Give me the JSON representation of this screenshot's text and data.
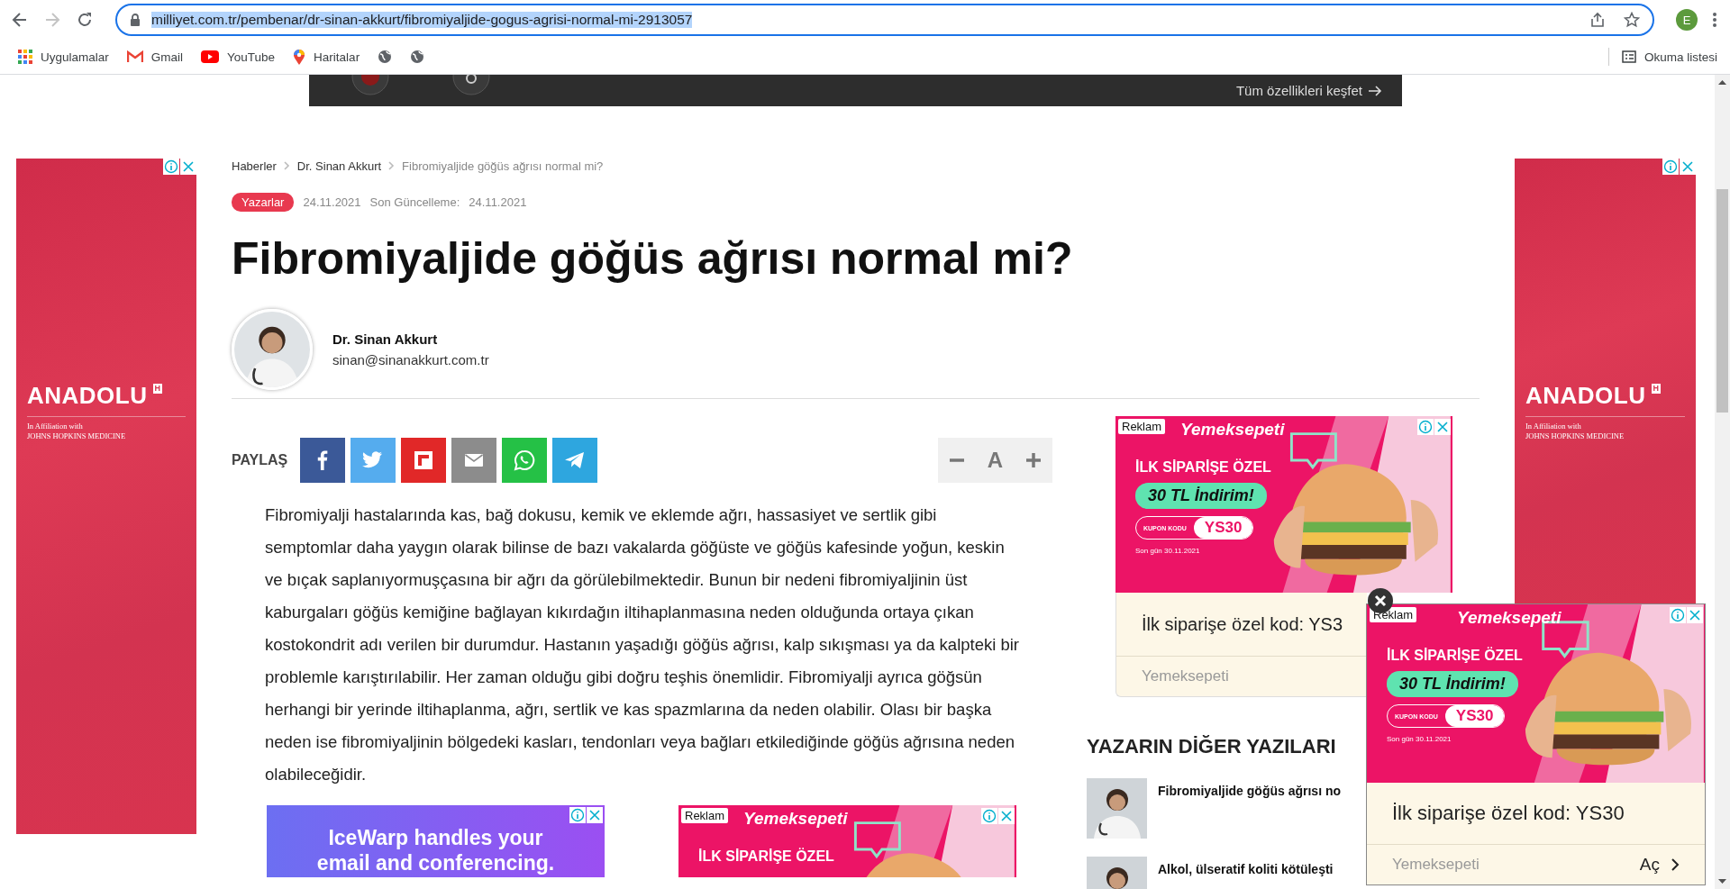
{
  "browser": {
    "back_enabled": true,
    "forward_enabled": false,
    "url": "milliyet.com.tr/pembenar/dr-sinan-akkurt/fibromiyaljide-gogus-agrisi-normal-mi-2913057",
    "url_selected": true,
    "profile_initial": "E"
  },
  "bookmarks": [
    {
      "kind": "apps",
      "label": "Uygulamalar"
    },
    {
      "kind": "gmail",
      "label": "Gmail"
    },
    {
      "kind": "youtube",
      "label": "YouTube"
    },
    {
      "kind": "maps",
      "label": "Haritalar"
    },
    {
      "kind": "globe"
    },
    {
      "kind": "globe"
    }
  ],
  "reading_list": {
    "label": "Okuma listesi"
  },
  "top_banner": {
    "link": "Tüm özellikleri keşfet"
  },
  "side_ads": [
    {
      "brand": "ANADOLU",
      "badge": "H",
      "line_1": "In Affiliation with",
      "line_2": "JOHNS HOPKINS MEDICINE"
    },
    {
      "brand": "ANADOLU",
      "badge": "H",
      "line_1": "In Affiliation with",
      "line_2": "JOHNS HOPKINS MEDICINE"
    }
  ],
  "article": {
    "breadcrumb": [
      "Haberler",
      "Dr. Sinan Akkurt",
      "Fibromiyaljide göğüs ağrısı normal mi?"
    ],
    "category": "Yazarlar",
    "date": "24.11.2021",
    "updated_label": "Son Güncelleme:",
    "updated_date": "24.11.2021",
    "title": "Fibromiyaljide göğüs ağrısı normal mi?",
    "author": {
      "name": "Dr. Sinan Akkurt",
      "email": "sinan@sinanakkurt.com.tr"
    },
    "share_label": "PAYLAŞ",
    "share_buttons": [
      {
        "kind": "facebook"
      },
      {
        "kind": "twitter"
      },
      {
        "kind": "flipboard"
      },
      {
        "kind": "email"
      },
      {
        "kind": "whatsapp"
      },
      {
        "kind": "telegram"
      }
    ],
    "font_size_label": "A",
    "body": "Fibromiyalji hastalarında kas, bağ dokusu, kemik ve eklemde ağrı, hassasiyet ve sertlik gibi semptomlar daha yaygın olarak bilinse de bazı vakalarda göğüste ve göğüs kafesinde yoğun, keskin ve bıçak saplanıyormuşçasına bir ağrı da görülebilmektedir. Bunun bir nedeni fibromiyaljinin üst kaburgaları göğüs kemiğine bağlayan kıkırdağın iltihaplanmasına neden olduğunda ortaya çıkan kostokondrit adı verilen bir durumdur. Hastanın yaşadığı göğüs ağrısı, kalp sıkışması ya da kalpteki bir problemle karıştırılabilir. Her zaman olduğu gibi doğru teşhis önemlidir. Fibromiyalji ayrıca göğsün herhangi bir yerinde iltihaplanma, ağrı, sertlik ve kas spazmlarına da neden olabilir. Olası bir başka neden ise fibromiyaljinin bölgedeki kasları, tendonları veya bağları etkilediğinde göğüs ağrısına neden olabileceğidir."
  },
  "bottom_ads": [
    {
      "kind": "icewarp",
      "text": "IceWarp handles your email and conferencing."
    },
    {
      "kind": "yemeksepeti",
      "label": "Reklam",
      "brand": "Yemeksepeti",
      "headline": "İLK SİPARİŞE ÖZEL"
    }
  ],
  "sidebar_ad": {
    "label": "Reklam",
    "brand": "Yemeksepeti",
    "headline": "İLK SİPARİŞE ÖZEL",
    "offer": "30 TL İndirim!",
    "coupon_label": "KUPON KODU",
    "coupon": "YS30",
    "deadline": "Son gün 30.11.2021",
    "caption": "İlk siparişe özel kod: YS3",
    "advertiser": "Yemeksepeti"
  },
  "other_posts": {
    "heading": "YAZARIN DİĞER YAZILARI",
    "items": [
      {
        "title": "Fibromiyaljide göğüs ağrısı no"
      },
      {
        "title": "Alkol, ülseratif koliti kötüleşti"
      }
    ]
  },
  "floating_ad": {
    "label": "Reklam",
    "brand": "Yemeksepeti",
    "headline": "İLK SİPARİŞE ÖZEL",
    "offer": "30 TL İndirim!",
    "coupon_label": "KUPON KODU",
    "coupon": "YS30",
    "deadline": "Son gün 30.11.2021",
    "caption": "İlk siparişe özel kod: YS30",
    "advertiser": "Yemeksepeti",
    "action": "Aç"
  }
}
